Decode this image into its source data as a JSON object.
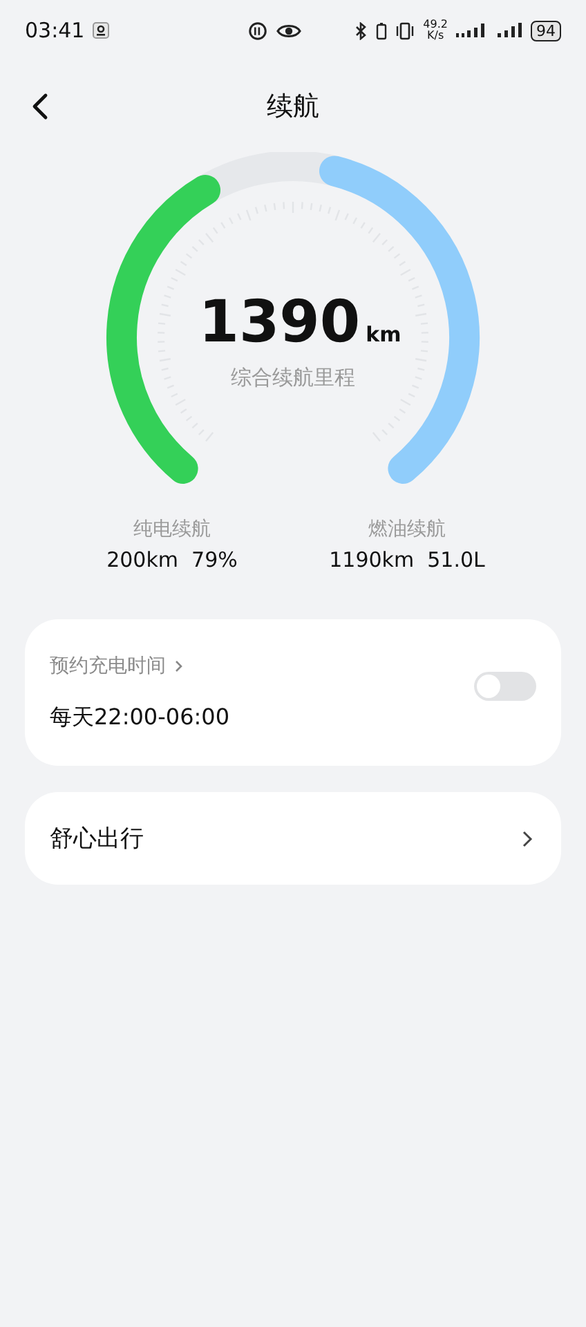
{
  "status_bar": {
    "time": "03:41",
    "speed_value": "49.2",
    "speed_unit": "K/s",
    "battery": "94"
  },
  "header": {
    "title": "续航"
  },
  "gauge": {
    "total": "1390",
    "unit": "km",
    "caption": "综合续航里程"
  },
  "electric": {
    "label": "纯电续航",
    "value": "200km  79%"
  },
  "fuel": {
    "label": "燃油续航",
    "value": "1190km  51.0L"
  },
  "schedule": {
    "title": "预约充电时间",
    "time": "每天22:00-06:00",
    "on": false
  },
  "comfort": {
    "title": "舒心出行"
  }
}
